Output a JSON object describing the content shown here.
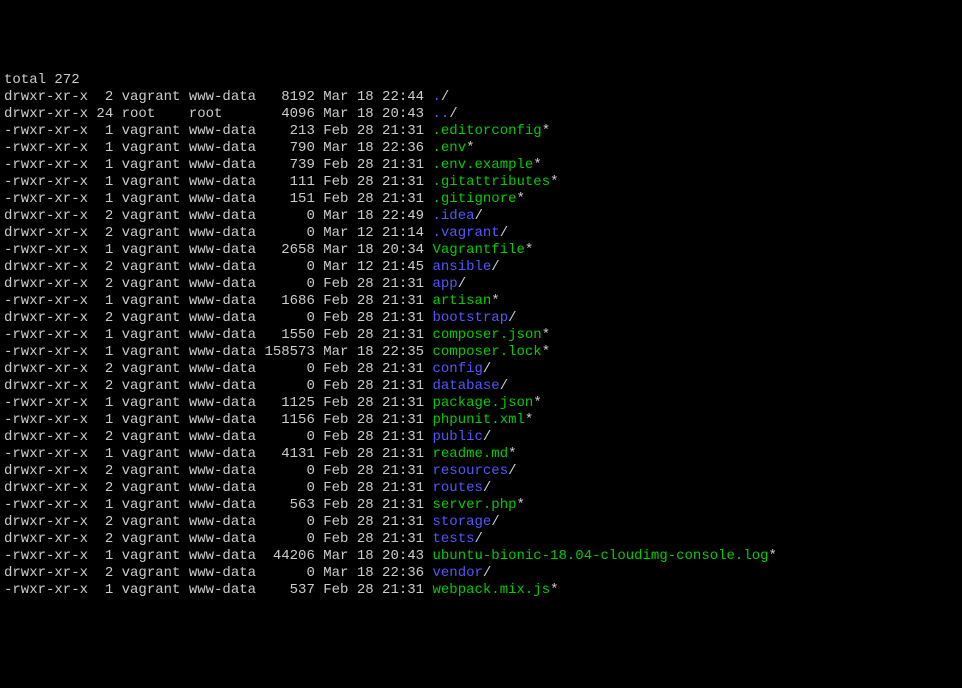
{
  "total_line": "total 272",
  "entries": [
    {
      "perms": "drwxr-xr-x",
      "links": 2,
      "owner": "vagrant",
      "group": "www-data",
      "size": 8192,
      "month": "Mar",
      "day": 18,
      "time": "22:44",
      "name": ".",
      "suffix": "/",
      "nameColor": "dir"
    },
    {
      "perms": "drwxr-xr-x",
      "links": 24,
      "owner": "root",
      "group": "root",
      "size": 4096,
      "month": "Mar",
      "day": 18,
      "time": "20:43",
      "name": "..",
      "suffix": "/",
      "nameColor": "dir"
    },
    {
      "perms": "-rwxr-xr-x",
      "links": 1,
      "owner": "vagrant",
      "group": "www-data",
      "size": 213,
      "month": "Feb",
      "day": 28,
      "time": "21:31",
      "name": ".editorconfig",
      "suffix": "*",
      "nameColor": "file"
    },
    {
      "perms": "-rwxr-xr-x",
      "links": 1,
      "owner": "vagrant",
      "group": "www-data",
      "size": 790,
      "month": "Mar",
      "day": 18,
      "time": "22:36",
      "name": ".env",
      "suffix": "*",
      "nameColor": "file"
    },
    {
      "perms": "-rwxr-xr-x",
      "links": 1,
      "owner": "vagrant",
      "group": "www-data",
      "size": 739,
      "month": "Feb",
      "day": 28,
      "time": "21:31",
      "name": ".env.example",
      "suffix": "*",
      "nameColor": "file"
    },
    {
      "perms": "-rwxr-xr-x",
      "links": 1,
      "owner": "vagrant",
      "group": "www-data",
      "size": 111,
      "month": "Feb",
      "day": 28,
      "time": "21:31",
      "name": ".gitattributes",
      "suffix": "*",
      "nameColor": "file"
    },
    {
      "perms": "-rwxr-xr-x",
      "links": 1,
      "owner": "vagrant",
      "group": "www-data",
      "size": 151,
      "month": "Feb",
      "day": 28,
      "time": "21:31",
      "name": ".gitignore",
      "suffix": "*",
      "nameColor": "file"
    },
    {
      "perms": "drwxr-xr-x",
      "links": 2,
      "owner": "vagrant",
      "group": "www-data",
      "size": 0,
      "month": "Mar",
      "day": 18,
      "time": "22:49",
      "name": ".idea",
      "suffix": "/",
      "nameColor": "dir"
    },
    {
      "perms": "drwxr-xr-x",
      "links": 2,
      "owner": "vagrant",
      "group": "www-data",
      "size": 0,
      "month": "Mar",
      "day": 12,
      "time": "21:14",
      "name": ".vagrant",
      "suffix": "/",
      "nameColor": "dir"
    },
    {
      "perms": "-rwxr-xr-x",
      "links": 1,
      "owner": "vagrant",
      "group": "www-data",
      "size": 2658,
      "month": "Mar",
      "day": 18,
      "time": "20:34",
      "name": "Vagrantfile",
      "suffix": "*",
      "nameColor": "file"
    },
    {
      "perms": "drwxr-xr-x",
      "links": 2,
      "owner": "vagrant",
      "group": "www-data",
      "size": 0,
      "month": "Mar",
      "day": 12,
      "time": "21:45",
      "name": "ansible",
      "suffix": "/",
      "nameColor": "dir"
    },
    {
      "perms": "drwxr-xr-x",
      "links": 2,
      "owner": "vagrant",
      "group": "www-data",
      "size": 0,
      "month": "Feb",
      "day": 28,
      "time": "21:31",
      "name": "app",
      "suffix": "/",
      "nameColor": "dir"
    },
    {
      "perms": "-rwxr-xr-x",
      "links": 1,
      "owner": "vagrant",
      "group": "www-data",
      "size": 1686,
      "month": "Feb",
      "day": 28,
      "time": "21:31",
      "name": "artisan",
      "suffix": "*",
      "nameColor": "file"
    },
    {
      "perms": "drwxr-xr-x",
      "links": 2,
      "owner": "vagrant",
      "group": "www-data",
      "size": 0,
      "month": "Feb",
      "day": 28,
      "time": "21:31",
      "name": "bootstrap",
      "suffix": "/",
      "nameColor": "dir"
    },
    {
      "perms": "-rwxr-xr-x",
      "links": 1,
      "owner": "vagrant",
      "group": "www-data",
      "size": 1550,
      "month": "Feb",
      "day": 28,
      "time": "21:31",
      "name": "composer.json",
      "suffix": "*",
      "nameColor": "file"
    },
    {
      "perms": "-rwxr-xr-x",
      "links": 1,
      "owner": "vagrant",
      "group": "www-data",
      "size": 158573,
      "month": "Mar",
      "day": 18,
      "time": "22:35",
      "name": "composer.lock",
      "suffix": "*",
      "nameColor": "file"
    },
    {
      "perms": "drwxr-xr-x",
      "links": 2,
      "owner": "vagrant",
      "group": "www-data",
      "size": 0,
      "month": "Feb",
      "day": 28,
      "time": "21:31",
      "name": "config",
      "suffix": "/",
      "nameColor": "dir"
    },
    {
      "perms": "drwxr-xr-x",
      "links": 2,
      "owner": "vagrant",
      "group": "www-data",
      "size": 0,
      "month": "Feb",
      "day": 28,
      "time": "21:31",
      "name": "database",
      "suffix": "/",
      "nameColor": "dir"
    },
    {
      "perms": "-rwxr-xr-x",
      "links": 1,
      "owner": "vagrant",
      "group": "www-data",
      "size": 1125,
      "month": "Feb",
      "day": 28,
      "time": "21:31",
      "name": "package.json",
      "suffix": "*",
      "nameColor": "file"
    },
    {
      "perms": "-rwxr-xr-x",
      "links": 1,
      "owner": "vagrant",
      "group": "www-data",
      "size": 1156,
      "month": "Feb",
      "day": 28,
      "time": "21:31",
      "name": "phpunit.xml",
      "suffix": "*",
      "nameColor": "file"
    },
    {
      "perms": "drwxr-xr-x",
      "links": 2,
      "owner": "vagrant",
      "group": "www-data",
      "size": 0,
      "month": "Feb",
      "day": 28,
      "time": "21:31",
      "name": "public",
      "suffix": "/",
      "nameColor": "dir"
    },
    {
      "perms": "-rwxr-xr-x",
      "links": 1,
      "owner": "vagrant",
      "group": "www-data",
      "size": 4131,
      "month": "Feb",
      "day": 28,
      "time": "21:31",
      "name": "readme.md",
      "suffix": "*",
      "nameColor": "file"
    },
    {
      "perms": "drwxr-xr-x",
      "links": 2,
      "owner": "vagrant",
      "group": "www-data",
      "size": 0,
      "month": "Feb",
      "day": 28,
      "time": "21:31",
      "name": "resources",
      "suffix": "/",
      "nameColor": "dir"
    },
    {
      "perms": "drwxr-xr-x",
      "links": 2,
      "owner": "vagrant",
      "group": "www-data",
      "size": 0,
      "month": "Feb",
      "day": 28,
      "time": "21:31",
      "name": "routes",
      "suffix": "/",
      "nameColor": "dir"
    },
    {
      "perms": "-rwxr-xr-x",
      "links": 1,
      "owner": "vagrant",
      "group": "www-data",
      "size": 563,
      "month": "Feb",
      "day": 28,
      "time": "21:31",
      "name": "server.php",
      "suffix": "*",
      "nameColor": "file"
    },
    {
      "perms": "drwxr-xr-x",
      "links": 2,
      "owner": "vagrant",
      "group": "www-data",
      "size": 0,
      "month": "Feb",
      "day": 28,
      "time": "21:31",
      "name": "storage",
      "suffix": "/",
      "nameColor": "dir"
    },
    {
      "perms": "drwxr-xr-x",
      "links": 2,
      "owner": "vagrant",
      "group": "www-data",
      "size": 0,
      "month": "Feb",
      "day": 28,
      "time": "21:31",
      "name": "tests",
      "suffix": "/",
      "nameColor": "dir"
    },
    {
      "perms": "-rwxr-xr-x",
      "links": 1,
      "owner": "vagrant",
      "group": "www-data",
      "size": 44206,
      "month": "Mar",
      "day": 18,
      "time": "20:43",
      "name": "ubuntu-bionic-18.04-cloudimg-console.log",
      "suffix": "*",
      "nameColor": "file"
    },
    {
      "perms": "drwxr-xr-x",
      "links": 2,
      "owner": "vagrant",
      "group": "www-data",
      "size": 0,
      "month": "Mar",
      "day": 18,
      "time": "22:36",
      "name": "vendor",
      "suffix": "/",
      "nameColor": "dir"
    },
    {
      "perms": "-rwxr-xr-x",
      "links": 1,
      "owner": "vagrant",
      "group": "www-data",
      "size": 537,
      "month": "Feb",
      "day": 28,
      "time": "21:31",
      "name": "webpack.mix.js",
      "suffix": "*",
      "nameColor": "file"
    }
  ]
}
